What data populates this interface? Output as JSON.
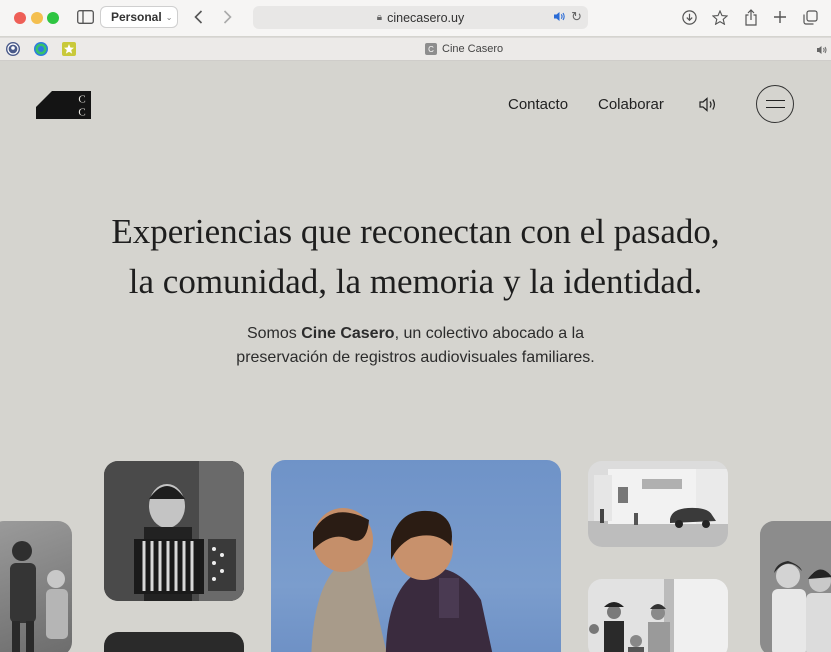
{
  "browser": {
    "profile_label": "Personal",
    "url": "cinecasero.uy",
    "tab_title": "Cine Casero",
    "tab_favicon_letter": "C"
  },
  "site": {
    "logo_letters": "CC",
    "nav": {
      "contact": "Contacto",
      "collaborate": "Colaborar"
    },
    "headline": {
      "line1": "Experiencias que reconectan con el pasado,",
      "line2": "la comunidad, la memoria y la identidad."
    },
    "intro": {
      "before": "Somos ",
      "brand": "Cine Casero",
      "after": ", un colectivo abocado a la",
      "line2": "preservación de registros audiovisuales familiares."
    }
  },
  "colors": {
    "page_bg": "#d5d4cf",
    "text": "#1e1e1e",
    "traffic_red": "#ee5f57",
    "traffic_yellow": "#f4bf4f",
    "traffic_green": "#2ec541"
  }
}
